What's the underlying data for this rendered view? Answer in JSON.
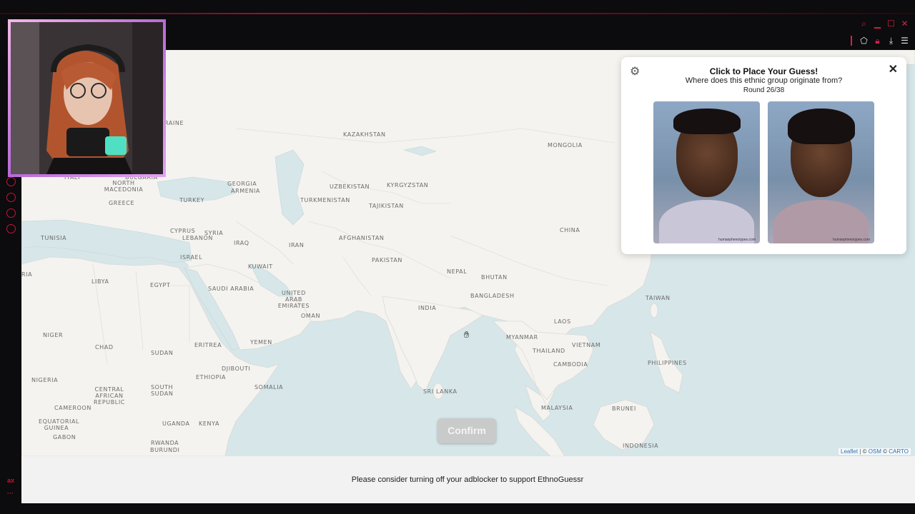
{
  "chrome": {
    "window_controls": [
      "search-icon",
      "minimize-icon",
      "maximize-icon",
      "close-icon"
    ],
    "toolbar_icons": [
      "extensions-icon",
      "lock-icon",
      "download-icon",
      "menu-icon"
    ],
    "rail_bottom_text": "ax",
    "accent": "#c21838"
  },
  "panel": {
    "title": "Click to Place Your Guess!",
    "question": "Where does this ethnic group originate from?",
    "round": "Round 26/38",
    "close_glyph": "✕",
    "gear_glyph": "⚙",
    "male_credit": "humanphenotypes.com",
    "female_credit": "humanphenotypes.com"
  },
  "map": {
    "labels": {
      "ukraine": "RAINE",
      "kazakhstan": "KAZAKHSTAN",
      "mongolia": "MONGOLIA",
      "italy": "ITALY",
      "north_macedonia": "NORTH MACEDONIA",
      "bulgaria": "BULGARIA",
      "georgia": "GEORGIA",
      "armenia": "ARMENIA",
      "uzbekistan": "UZBEKISTAN",
      "kyrgyzstan": "KYRGYZSTAN",
      "greece": "GREECE",
      "turkey": "TURKEY",
      "turkmenistan": "TURKMENISTAN",
      "tajikistan": "TAJIKISTAN",
      "tunisia": "TUNISIA",
      "cyprus": "CYPRUS",
      "lebanon": "LEBANON",
      "syria": "SYRIA",
      "iraq": "IRAQ",
      "iran": "IRAN",
      "afghanistan": "AFGHANISTAN",
      "china": "CHINA",
      "israel": "ISRAEL",
      "pakistan": "PAKISTAN",
      "kuwait": "KUWAIT",
      "nepal": "NEPAL",
      "bhutan": "BHUTAN",
      "libya": "LIBYA",
      "egypt": "EGYPT",
      "saudi_arabia": "SAUDI ARABIA",
      "uae": "UNITED ARAB EMIRATES",
      "bangladesh": "BANGLADESH",
      "india": "INDIA",
      "taiwan": "TAIWAN",
      "oman": "OMAN",
      "laos": "LAOS",
      "niger": "NIGER",
      "myanmar": "MYANMAR",
      "yemen": "YEMEN",
      "chad": "CHAD",
      "eritrea": "ERITREA",
      "vietnam": "VIETNAM",
      "sudan": "SUDAN",
      "thailand": "THAILAND",
      "philippines": "PHILIPPINES",
      "djibouti": "DJIBOUTI",
      "cambodia": "CAMBODIA",
      "nigeria": "NIGERIA",
      "ethiopia": "ETHIOPIA",
      "somalia": "SOMALIA",
      "car": "CENTRAL AFRICAN REPUBLIC",
      "south_sudan": "SOUTH SUDAN",
      "sri_lanka": "SRI LANKA",
      "cameroon": "CAMEROON",
      "malaysia": "MALAYSIA",
      "brunei": "BRUNEI",
      "eq_guinea": "EQUATORIAL GUINEA",
      "gabon": "GABON",
      "uganda": "UGANDA",
      "kenya": "KENYA",
      "rwanda": "RWANDA",
      "burundi": "BURUNDI",
      "indonesia": "INDONESIA",
      "edge_ria": "RIA"
    },
    "attribution": {
      "leaflet": "Leaflet",
      "sep": " | © ",
      "osm": "OSM",
      "sep2": " © ",
      "carto": "CARTO"
    }
  },
  "confirm_label": "Confirm",
  "footer_message": "Please consider turning off your adblocker to support EthnoGuessr"
}
